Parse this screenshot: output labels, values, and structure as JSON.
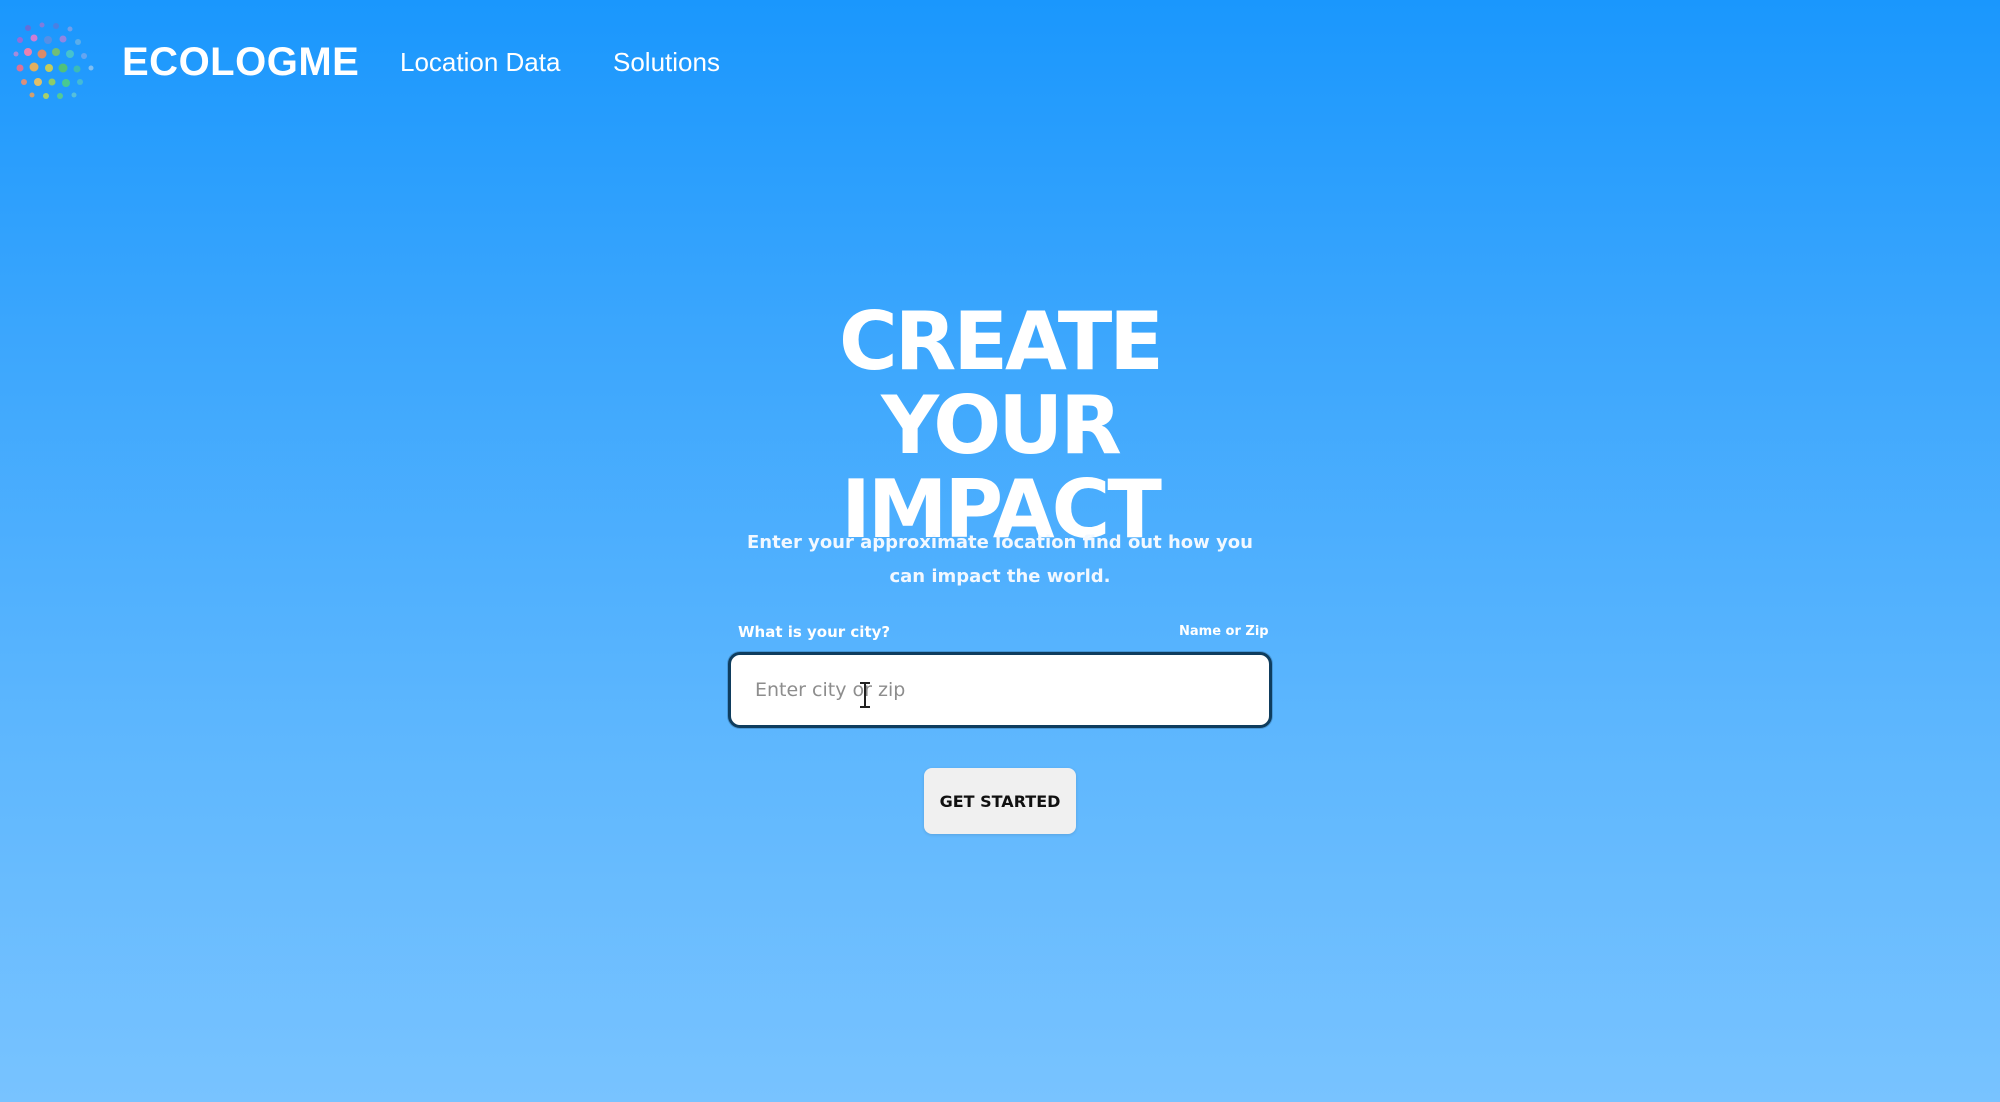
{
  "nav": {
    "brand": "ECOLOGME",
    "logo_icon": "dot-cluster-logo-icon",
    "links": [
      {
        "label": "Location Data"
      },
      {
        "label": "Solutions"
      }
    ]
  },
  "hero": {
    "title_line1": "CREATE YOUR",
    "title_line2": "IMPACT",
    "subtitle": "Enter your approximate location find out how you can impact the world.",
    "form": {
      "label": "What is your city?",
      "hint": "Name or Zip",
      "value": "",
      "placeholder": "Enter city or zip",
      "button_label": "GET STARTED",
      "cursor_icon": "text-cursor-icon"
    }
  },
  "colors": {
    "background_top": "#1a97fd",
    "background_bottom": "#78c3ff",
    "input_border": "#0f3d5e",
    "button_bg": "#f0f0f0",
    "text": "#ffffff"
  }
}
